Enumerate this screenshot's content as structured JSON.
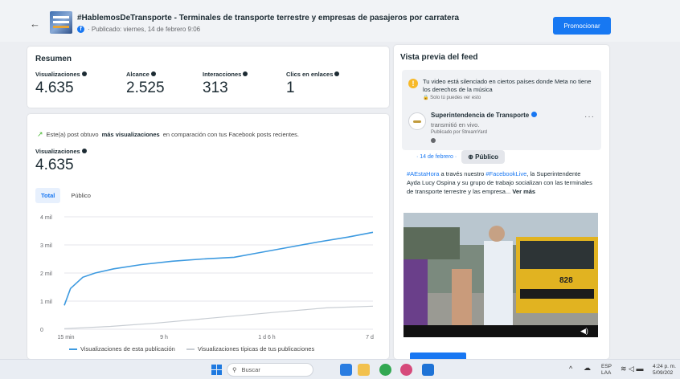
{
  "header": {
    "back_icon": "arrow-left-icon",
    "title": "#HablemosDeTransporte - Terminales de transporte terrestre y empresas de pasajeros por carratera",
    "meta": "· Publicado: viernes, 14 de febrero 9:06",
    "promote_label": "Promocionar",
    "accent": "#1778f2"
  },
  "summary": {
    "title": "Resumen",
    "metrics": [
      {
        "label": "Visualizaciones",
        "value": "4.635"
      },
      {
        "label": "Alcance",
        "value": "2.525"
      },
      {
        "label": "Interacciones",
        "value": "313"
      },
      {
        "label": "Clics en enlaces",
        "value": "1"
      }
    ]
  },
  "chart_panel": {
    "trend_prefix": "Este(a) post obtuvo",
    "trend_bold": "más visualizaciones",
    "trend_suffix": "en comparación con tus Facebook posts recientes.",
    "metric_label": "Visualizaciones",
    "metric_value": "4.635",
    "tabs": [
      "Total",
      "Público"
    ],
    "active_tab": "Total"
  },
  "chart_data": {
    "type": "line",
    "x_ticks": [
      "15 min",
      "9 h",
      "1 d 6 h",
      "7 d"
    ],
    "y_ticks": [
      "0",
      "1 mil",
      "2 mil",
      "3 mil",
      "4 mil"
    ],
    "ylim": [
      0,
      4000
    ],
    "grid": true,
    "series": [
      {
        "name": "Visualizaciones de esta publicación",
        "color": "#3d9ae0",
        "values": [
          [
            0.0,
            850
          ],
          [
            0.02,
            1450
          ],
          [
            0.06,
            1850
          ],
          [
            0.1,
            2000
          ],
          [
            0.16,
            2150
          ],
          [
            0.25,
            2300
          ],
          [
            0.35,
            2420
          ],
          [
            0.45,
            2500
          ],
          [
            0.55,
            2560
          ],
          [
            0.62,
            2700
          ],
          [
            0.72,
            2900
          ],
          [
            0.82,
            3100
          ],
          [
            0.92,
            3280
          ],
          [
            1.0,
            3450
          ]
        ]
      },
      {
        "name": "Visualizaciones típicas de tus publicaciones",
        "color": "#c8cdd3",
        "values": [
          [
            0.0,
            20
          ],
          [
            0.15,
            100
          ],
          [
            0.3,
            220
          ],
          [
            0.5,
            420
          ],
          [
            0.7,
            620
          ],
          [
            0.85,
            760
          ],
          [
            1.0,
            820
          ]
        ]
      }
    ],
    "legend": "bottom"
  },
  "preview": {
    "title": "Vista previa del feed",
    "warning_text": "Tu video está silenciado en ciertos países donde Meta no tiene los derechos de la música",
    "warning_sub": "Solo tú puedes ver esto",
    "page_name": "Superintendencia de Transporte",
    "live_text": "transmitió en vivo.",
    "via_text": "Publicado por StreamYard",
    "date_link": "· 14 de febrero ·",
    "audience_chip": "Público",
    "caption_hashtag1": "#AEstaHora",
    "caption_mid1": "a través nuestro",
    "caption_hashtag2": "#FacebookLive",
    "caption_rest": ", la Superintendente Ayda Lucy Ospina y su grupo de trabajo socializan con las terminales de transporte terrestre y las empresa...",
    "see_more": "Ver más",
    "bus_text": "828"
  },
  "taskbar": {
    "search_placeholder": "Buscar",
    "lang": "ESP",
    "layout": "LAA",
    "time": "4:24 p. m.",
    "date": "5/09/202"
  }
}
